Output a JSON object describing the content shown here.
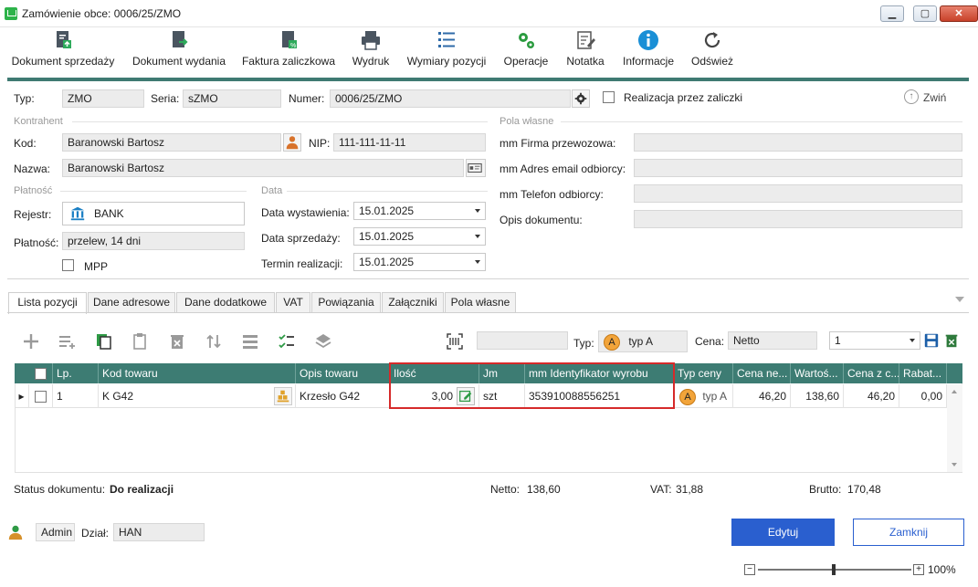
{
  "window": {
    "title": "Zamówienie obce: 0006/25/ZMO"
  },
  "toolbar": {
    "items": [
      {
        "label": "Dokument sprzedaży"
      },
      {
        "label": "Dokument wydania"
      },
      {
        "label": "Faktura zaliczkowa"
      },
      {
        "label": "Wydruk"
      },
      {
        "label": "Wymiary pozycji"
      },
      {
        "label": "Operacje"
      },
      {
        "label": "Notatka"
      },
      {
        "label": "Informacje"
      },
      {
        "label": "Odśwież"
      }
    ]
  },
  "header": {
    "typ_label": "Typ:",
    "typ_value": "ZMO",
    "seria_label": "Seria:",
    "seria_value": "sZMO",
    "numer_label": "Numer:",
    "numer_value": "0006/25/ZMO",
    "zaliczki_label": "Realizacja przez zaliczki",
    "zwin_label": "Zwiń"
  },
  "kontrahent": {
    "section": "Kontrahent",
    "kod_label": "Kod:",
    "kod_value": "Baranowski Bartosz",
    "nip_label": "NIP:",
    "nip_value": "111-111-11-11",
    "nazwa_label": "Nazwa:",
    "nazwa_value": "Baranowski Bartosz"
  },
  "platnosc": {
    "section": "Płatność",
    "rejestr_label": "Rejestr:",
    "rejestr_value": "BANK",
    "platnosc_label": "Płatność:",
    "platnosc_value": "przelew, 14 dni",
    "mpp_label": "MPP"
  },
  "data_section": {
    "section": "Data",
    "wystawienia_label": "Data wystawienia:",
    "wystawienia_value": "15.01.2025",
    "sprzedazy_label": "Data sprzedaży:",
    "sprzedazy_value": "15.01.2025",
    "termin_label": "Termin realizacji:",
    "termin_value": "15.01.2025"
  },
  "pola_wlasne": {
    "section": "Pola własne",
    "firma_label": "mm Firma przewozowa:",
    "email_label": "mm Adres email odbiorcy:",
    "telefon_label": "mm Telefon odbiorcy:",
    "opis_label": "Opis dokumentu:"
  },
  "tabs": [
    {
      "label": "Lista pozycji"
    },
    {
      "label": "Dane adresowe"
    },
    {
      "label": "Dane dodatkowe"
    },
    {
      "label": "VAT"
    },
    {
      "label": "Powiązania"
    },
    {
      "label": "Załączniki"
    },
    {
      "label": "Pola własne"
    }
  ],
  "grid_toolbar": {
    "typ_label": "Typ:",
    "typ_badge": "A",
    "typ_value": "typ A",
    "cena_label": "Cena:",
    "cena_value": "Netto",
    "qty_value": "1"
  },
  "table": {
    "columns": [
      "Lp.",
      "Kod towaru",
      "Opis towaru",
      "Ilość",
      "Jm",
      "mm Identyfikator wyrobu",
      "Typ ceny",
      "Cena ne...",
      "Wartoś...",
      "Cena z c...",
      "Rabat..."
    ],
    "rows": [
      {
        "lp": "1",
        "kod": "K G42",
        "opis": "Krzesło G42",
        "ilosc": "3,00",
        "jm": "szt",
        "identyfikator": "353910088556251",
        "typ_badge": "A",
        "typ_ceny": "typ A",
        "cena_netto": "46,20",
        "wartosc": "138,60",
        "cena_z_c": "46,20",
        "rabat": "0,00"
      }
    ]
  },
  "summary": {
    "status_label": "Status dokumentu:",
    "status_value": "Do realizacji",
    "netto_label": "Netto:",
    "netto_value": "138,60",
    "vat_label": "VAT:",
    "vat_value": "31,88",
    "brutto_label": "Brutto:",
    "brutto_value": "170,48"
  },
  "footer": {
    "user": "Admin",
    "dzial_label": "Dział:",
    "dzial_value": "HAN",
    "edytuj": "Edytuj",
    "zamknij": "Zamknij",
    "zoom": "100%"
  },
  "colors": {
    "accent": "#3d7c73",
    "primary_button": "#2a5fcf",
    "highlight": "#d62a2a"
  }
}
